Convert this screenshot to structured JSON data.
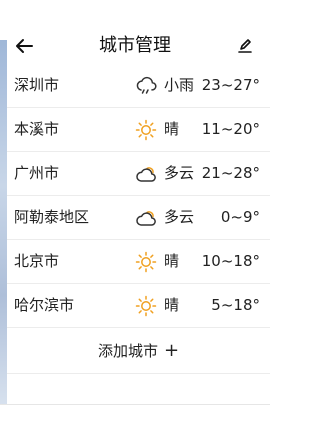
{
  "header": {
    "title": "城市管理"
  },
  "cities": [
    {
      "name": "深圳市",
      "icon": "cloud-rain-icon",
      "condition": "小雨",
      "temp": "23~27°"
    },
    {
      "name": "本溪市",
      "icon": "sun-icon",
      "condition": "晴",
      "temp": "11~20°"
    },
    {
      "name": "广州市",
      "icon": "partly-cloudy-icon",
      "condition": "多云",
      "temp": "21~28°"
    },
    {
      "name": "阿勒泰地区",
      "icon": "partly-cloudy-icon",
      "condition": "多云",
      "temp": "0~9°"
    },
    {
      "name": "北京市",
      "icon": "sun-icon",
      "condition": "晴",
      "temp": "10~18°"
    },
    {
      "name": "哈尔滨市",
      "icon": "sun-icon",
      "condition": "晴",
      "temp": "5~18°"
    }
  ],
  "add_city": {
    "label": "添加城市",
    "plus": "+"
  },
  "colors": {
    "sun": "#f0a020",
    "cloud_outline": "#333333",
    "divider": "#ececec"
  }
}
